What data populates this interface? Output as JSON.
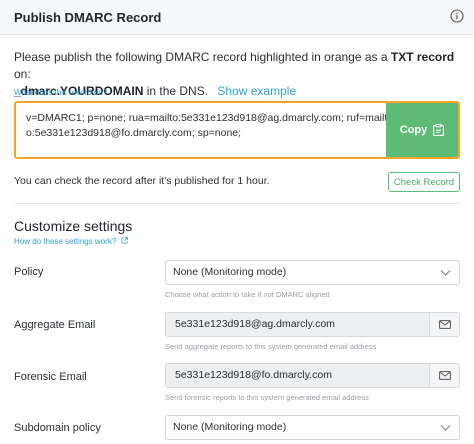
{
  "header": {
    "title": "Publish DMARC Record",
    "info_icon": "info-icon"
  },
  "intro": {
    "text_before": "Please publish the following DMARC record highlighted in orange as a ",
    "txt_record": "TXT record",
    "text_on": " on:",
    "domain": "_dmarc.YOURDOMAIN",
    "text_after": " in the DNS.",
    "show_example": "Show example"
  },
  "what_does_link": "What does this record do?",
  "record": {
    "value": "v=DMARC1; p=none; rua=mailto:5e331e123d918@ag.dmarcly.com; ruf=mailto:5e331e123d918@fo.dmarcly.com; sp=none;",
    "copy_label": "Copy",
    "copy_icon": "clipboard-icon",
    "border_color": "#f5a623",
    "copy_color": "#5dbb76"
  },
  "check": {
    "hint": "You can check the record after it's published for 1 hour.",
    "button": "Check Record"
  },
  "customize": {
    "title": "Customize settings",
    "how_link": "How do these settings work?",
    "fields": {
      "policy": {
        "label": "Policy",
        "value": "None (Monitoring mode)",
        "hint": "Choose what action to take if not DMARC aligned"
      },
      "aggregate": {
        "label": "Aggregate Email",
        "value": "5e331e123d918@ag.dmarcly.com",
        "hint": "Send aggregate reports to this system generated email address"
      },
      "forensic": {
        "label": "Forensic Email",
        "value": "5e331e123d918@fo.dmarcly.com",
        "hint": "Send forensic reports to this system generated email address"
      },
      "subdomain": {
        "label": "Subdomain policy",
        "value": "None (Monitoring mode)"
      }
    }
  }
}
